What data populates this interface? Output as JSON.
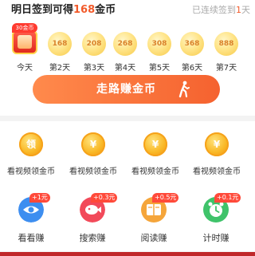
{
  "signin": {
    "title_prefix": "明日签到可得",
    "title_amount": "168",
    "title_suffix": "金币",
    "streak_prefix": "已连续签到",
    "streak_days": "1",
    "streak_suffix": "天",
    "today": {
      "badge": "30金币",
      "label": "今天"
    },
    "days": [
      {
        "coins": "168",
        "label": "第2天"
      },
      {
        "coins": "208",
        "label": "第3天"
      },
      {
        "coins": "268",
        "label": "第4天"
      },
      {
        "coins": "308",
        "label": "第5天"
      },
      {
        "coins": "368",
        "label": "第6天"
      },
      {
        "coins": "888",
        "label": "第7天"
      }
    ],
    "walk_button": "走路赚金币"
  },
  "videos": [
    {
      "label": "看视频领金币",
      "icon_text": "领",
      "icon": "coin-claim-icon"
    },
    {
      "label": "看视频领金币",
      "icon_text": "¥",
      "icon": "yuan-coin-icon"
    },
    {
      "label": "看视频领金币",
      "icon_text": "¥",
      "icon": "yuan-coin-icon"
    },
    {
      "label": "看视频领金币",
      "icon_text": "¥",
      "icon": "yuan-coin-icon"
    }
  ],
  "tasks": [
    {
      "label": "看看赚",
      "badge": "+1元",
      "icon": "eye-icon",
      "color": "#3d8ef0",
      "badge_color": "#ff4a3a"
    },
    {
      "label": "搜索赚",
      "badge": "+0.3元",
      "icon": "search-fish-icon",
      "color": "#f24a5a",
      "badge_color": "#ff4a3a"
    },
    {
      "label": "阅读赚",
      "badge": "+0.5元",
      "icon": "book-icon",
      "color": "#f5a53a",
      "badge_color": "#ff4a3a"
    },
    {
      "label": "计时赚",
      "badge": "+0.1元",
      "icon": "alarm-clock-icon",
      "color": "#3fc36a",
      "badge_color": "#ff4a3a"
    }
  ]
}
